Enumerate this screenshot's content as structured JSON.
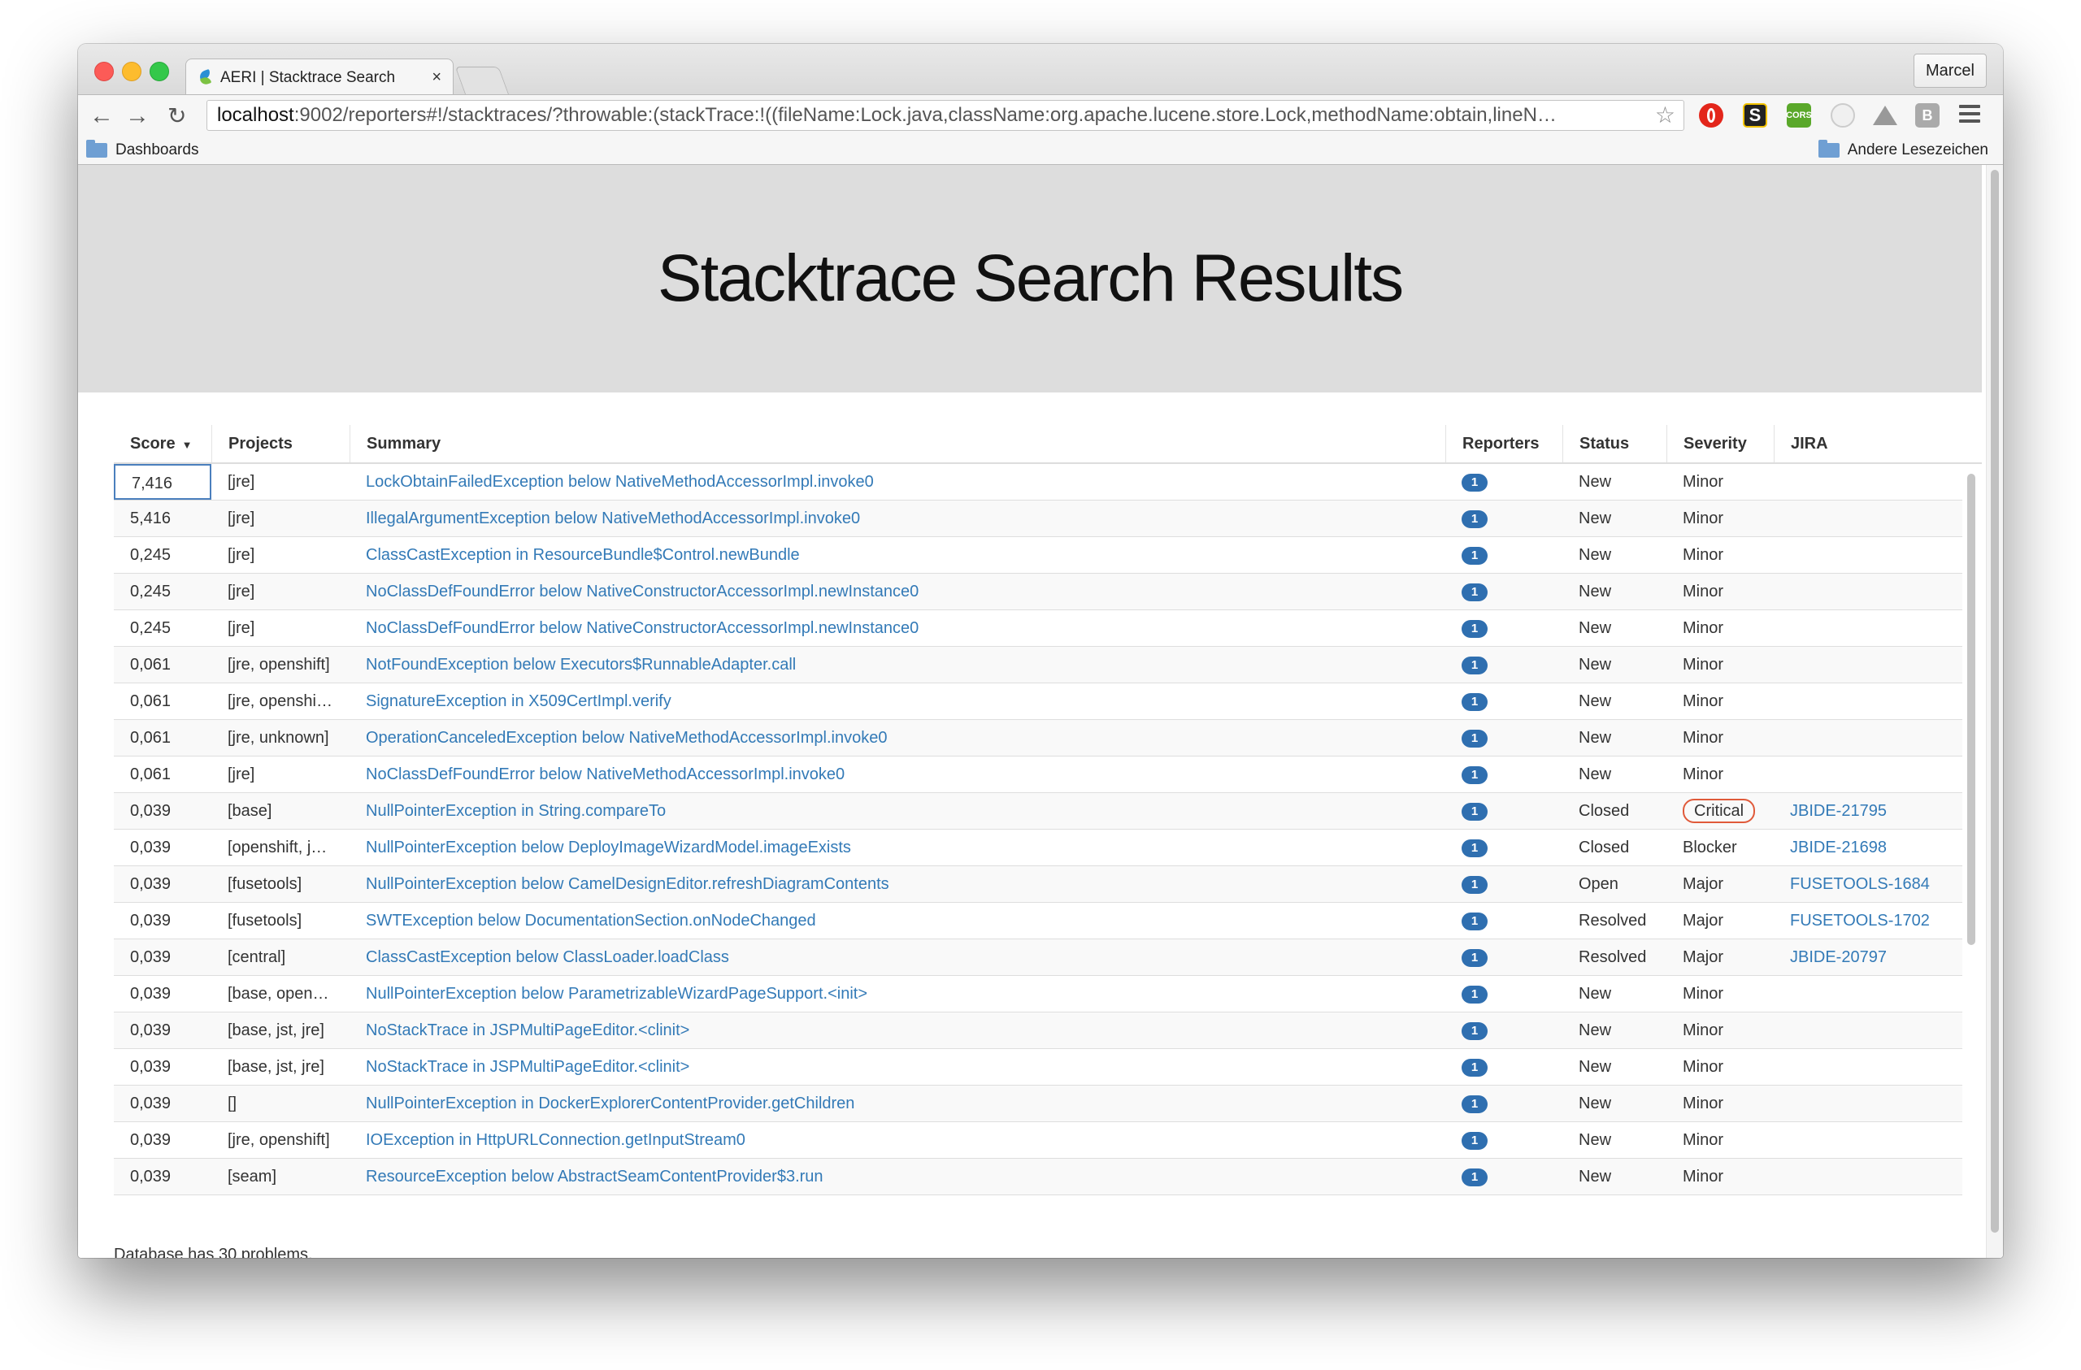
{
  "browser": {
    "tab_title": "AERI | Stacktrace Search",
    "tab_close": "×",
    "user": "Marcel",
    "address_host": "localhost",
    "address_rest": ":9002/reporters#!/stacktraces/?throwable:(stackTrace:!((fileName:Lock.java,className:org.apache.lucene.store.Lock,methodName:obtain,lineN…",
    "bookmarks": {
      "left": "Dashboards",
      "right": "Andere Lesezeichen"
    },
    "extensions": {
      "s_label": "S",
      "cors_label": "CORS",
      "b_label": "B"
    }
  },
  "page": {
    "title": "Stacktrace Search Results",
    "footer": "Database has 30 problems."
  },
  "table": {
    "columns": {
      "score": "Score",
      "projects": "Projects",
      "summary": "Summary",
      "reporters": "Reporters",
      "status": "Status",
      "severity": "Severity",
      "jira": "JIRA"
    },
    "rows": [
      {
        "score": "7,416",
        "projects": "[jre]",
        "summary": "LockObtainFailedException below NativeMethodAccessorImpl.invoke0",
        "reporters": "1",
        "status": "New",
        "severity": "Minor",
        "jira": ""
      },
      {
        "score": "5,416",
        "projects": "[jre]",
        "summary": "IllegalArgumentException below NativeMethodAccessorImpl.invoke0",
        "reporters": "1",
        "status": "New",
        "severity": "Minor",
        "jira": ""
      },
      {
        "score": "0,245",
        "projects": "[jre]",
        "summary": "ClassCastException in ResourceBundle$Control.newBundle",
        "reporters": "1",
        "status": "New",
        "severity": "Minor",
        "jira": ""
      },
      {
        "score": "0,245",
        "projects": "[jre]",
        "summary": "NoClassDefFoundError below NativeConstructorAccessorImpl.newInstance0",
        "reporters": "1",
        "status": "New",
        "severity": "Minor",
        "jira": ""
      },
      {
        "score": "0,245",
        "projects": "[jre]",
        "summary": "NoClassDefFoundError below NativeConstructorAccessorImpl.newInstance0",
        "reporters": "1",
        "status": "New",
        "severity": "Minor",
        "jira": ""
      },
      {
        "score": "0,061",
        "projects": "[jre, openshift]",
        "summary": "NotFoundException below Executors$RunnableAdapter.call",
        "reporters": "1",
        "status": "New",
        "severity": "Minor",
        "jira": ""
      },
      {
        "score": "0,061",
        "projects": "[jre, openshi…",
        "summary": "SignatureException in X509CertImpl.verify",
        "reporters": "1",
        "status": "New",
        "severity": "Minor",
        "jira": ""
      },
      {
        "score": "0,061",
        "projects": "[jre, unknown]",
        "summary": "OperationCanceledException below NativeMethodAccessorImpl.invoke0",
        "reporters": "1",
        "status": "New",
        "severity": "Minor",
        "jira": ""
      },
      {
        "score": "0,061",
        "projects": "[jre]",
        "summary": "NoClassDefFoundError below NativeMethodAccessorImpl.invoke0",
        "reporters": "1",
        "status": "New",
        "severity": "Minor",
        "jira": ""
      },
      {
        "score": "0,039",
        "projects": "[base]",
        "summary": "NullPointerException in String.compareTo",
        "reporters": "1",
        "status": "Closed",
        "severity": "Critical",
        "jira": "JBIDE-21795"
      },
      {
        "score": "0,039",
        "projects": "[openshift, j…",
        "summary": "NullPointerException below DeployImageWizardModel.imageExists",
        "reporters": "1",
        "status": "Closed",
        "severity": "Blocker",
        "jira": "JBIDE-21698"
      },
      {
        "score": "0,039",
        "projects": "[fusetools]",
        "summary": "NullPointerException below CamelDesignEditor.refreshDiagramContents",
        "reporters": "1",
        "status": "Open",
        "severity": "Major",
        "jira": "FUSETOOLS-1684"
      },
      {
        "score": "0,039",
        "projects": "[fusetools]",
        "summary": "SWTException below DocumentationSection.onNodeChanged",
        "reporters": "1",
        "status": "Resolved",
        "severity": "Major",
        "jira": "FUSETOOLS-1702"
      },
      {
        "score": "0,039",
        "projects": "[central]",
        "summary": "ClassCastException below ClassLoader.loadClass",
        "reporters": "1",
        "status": "Resolved",
        "severity": "Major",
        "jira": "JBIDE-20797"
      },
      {
        "score": "0,039",
        "projects": "[base, open…",
        "summary": "NullPointerException below ParametrizableWizardPageSupport.<init>",
        "reporters": "1",
        "status": "New",
        "severity": "Minor",
        "jira": ""
      },
      {
        "score": "0,039",
        "projects": "[base, jst, jre]",
        "summary": "NoStackTrace in JSPMultiPageEditor.<clinit>",
        "reporters": "1",
        "status": "New",
        "severity": "Minor",
        "jira": ""
      },
      {
        "score": "0,039",
        "projects": "[base, jst, jre]",
        "summary": "NoStackTrace in JSPMultiPageEditor.<clinit>",
        "reporters": "1",
        "status": "New",
        "severity": "Minor",
        "jira": ""
      },
      {
        "score": "0,039",
        "projects": "[]",
        "summary": "NullPointerException in DockerExplorerContentProvider.getChildren",
        "reporters": "1",
        "status": "New",
        "severity": "Minor",
        "jira": ""
      },
      {
        "score": "0,039",
        "projects": "[jre, openshift]",
        "summary": "IOException in HttpURLConnection.getInputStream0",
        "reporters": "1",
        "status": "New",
        "severity": "Minor",
        "jira": ""
      },
      {
        "score": "0,039",
        "projects": "[seam]",
        "summary": "ResourceException below AbstractSeamContentProvider$3.run",
        "reporters": "1",
        "status": "New",
        "severity": "Minor",
        "jira": ""
      }
    ]
  },
  "colors": {
    "link": "#337ab7",
    "badge": "#2f6fb0",
    "critical_border": "#e05a3a",
    "jumbotron": "#dddddd"
  },
  "icons": [
    "back-icon",
    "forward-icon",
    "reload-icon",
    "star-icon",
    "menu-icon",
    "folder-icon",
    "sort-desc-icon"
  ]
}
